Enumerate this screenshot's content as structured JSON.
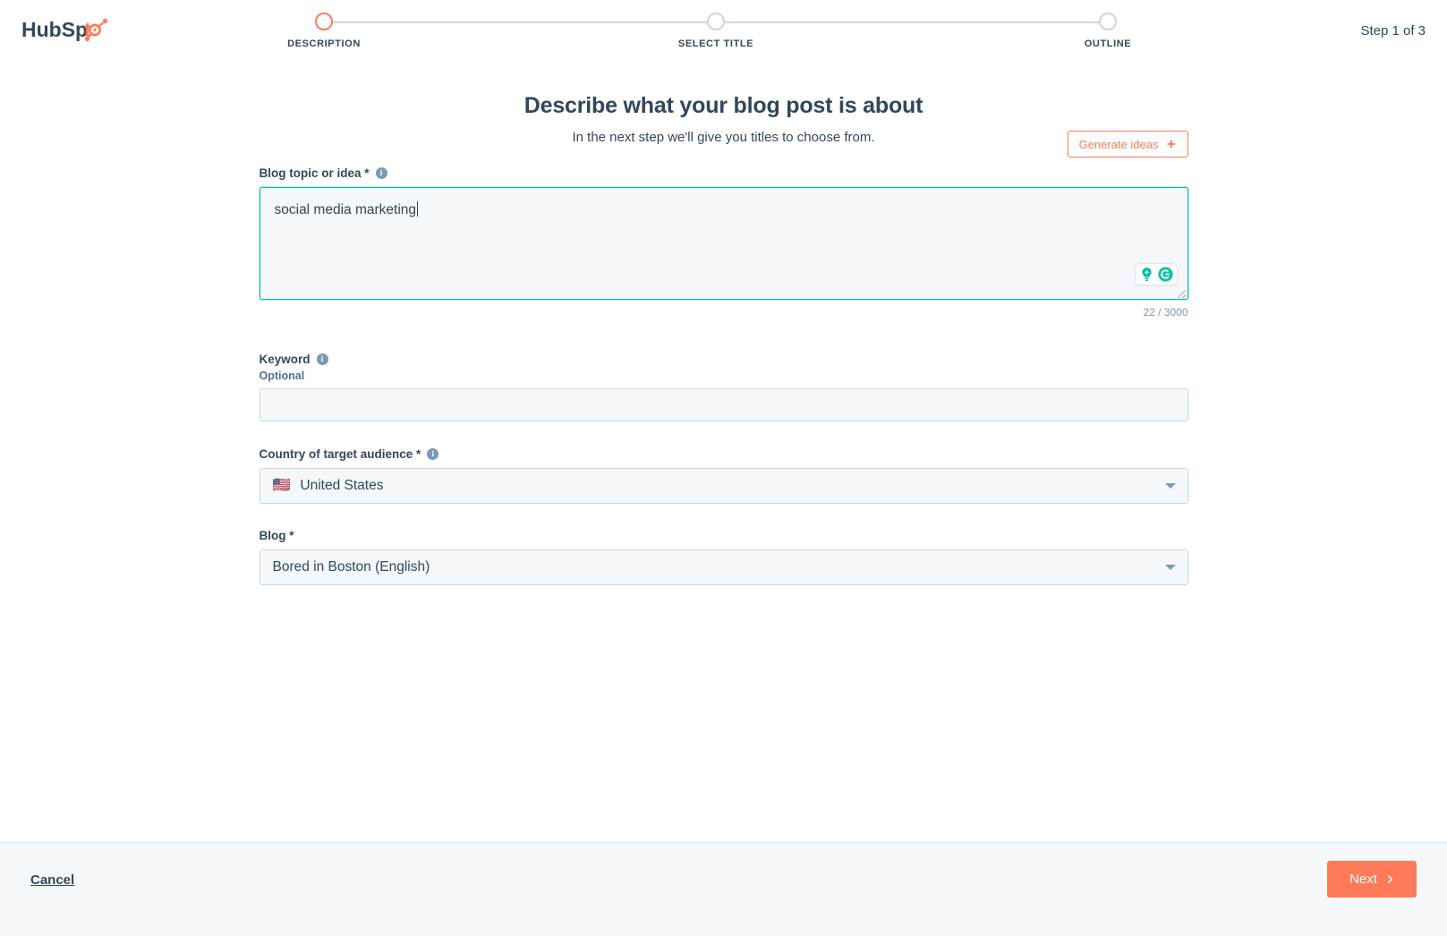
{
  "brand": {
    "logo_text": "HubSpot",
    "accent_color": "#ff7a59",
    "dark_color": "#33475b",
    "focus_color": "#00bda5"
  },
  "stepper": {
    "steps": [
      {
        "label": "DESCRIPTION",
        "state": "active"
      },
      {
        "label": "SELECT TITLE",
        "state": "upcoming"
      },
      {
        "label": "OUTLINE",
        "state": "upcoming"
      }
    ],
    "progress_text": "Step 1 of 3"
  },
  "main": {
    "title": "Describe what your blog post is about",
    "subtitle": "In the next step we'll give you titles to choose from."
  },
  "form": {
    "topic": {
      "label": "Blog topic or idea *",
      "info_glyph": "i",
      "value": "social media marketing",
      "placeholder": "",
      "char_count": "22 / 3000",
      "generate_button": "Generate ideas"
    },
    "keyword": {
      "label": "Keyword",
      "sublabel": "Optional",
      "info_glyph": "i",
      "value": "",
      "placeholder": ""
    },
    "country": {
      "label": "Country of target audience *",
      "info_glyph": "i",
      "flag": "🇺🇸",
      "value": "United States"
    },
    "blog": {
      "label": "Blog *",
      "value": "Bored in Boston (English)"
    }
  },
  "footer": {
    "cancel_label": "Cancel",
    "next_label": "Next"
  }
}
